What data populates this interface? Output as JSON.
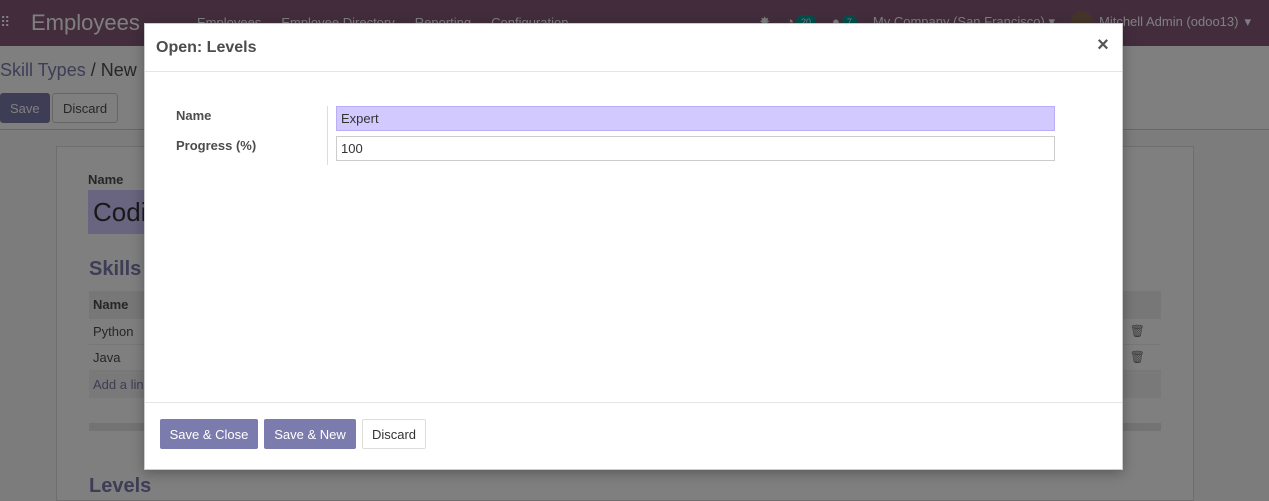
{
  "app": {
    "brand": "Employees",
    "menu": [
      "Employees",
      "Employee Directory",
      "Reporting",
      "Configuration"
    ],
    "activity_count": "20",
    "message_count": "7",
    "company": "My Company (San Francisco)",
    "user": "Mitchell Admin (odoo13)"
  },
  "breadcrumb": {
    "parent": "Skill Types",
    "separator": "/",
    "current": "New"
  },
  "control_panel": {
    "save_label": "Save",
    "discard_label": "Discard"
  },
  "form": {
    "name_label": "Name",
    "name_value": "Codi",
    "skills_title": "Skills",
    "skills_header": "Name",
    "skills": [
      "Python",
      "Java"
    ],
    "add_line": "Add a lin",
    "levels_title": "Levels"
  },
  "dialog": {
    "title": "Open: Levels",
    "close_glyph": "×",
    "fields": {
      "name_label": "Name",
      "name_value": "Expert",
      "progress_label": "Progress (%)",
      "progress_value": "100"
    },
    "buttons": {
      "save_close": "Save & Close",
      "save_new": "Save & New",
      "discard": "Discard"
    }
  },
  "colors": {
    "brand": "#875a7b",
    "primary": "#7c7bad",
    "required_field": "#d2c9ff"
  }
}
